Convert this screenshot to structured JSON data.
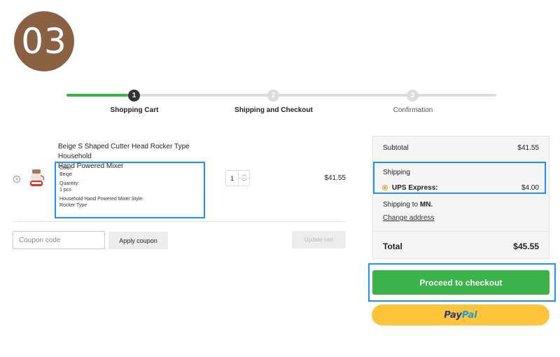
{
  "step_badge": "03",
  "progress": {
    "steps": [
      {
        "number": "1",
        "label": "Shopping Cart"
      },
      {
        "number": "2",
        "label": "Shipping and Checkout"
      },
      {
        "number": "3",
        "label": "Confirmation"
      }
    ],
    "active_color": "#3bb24a"
  },
  "cart": {
    "item": {
      "title_line1": "Beige S Shaped Cutter Head Rocker Type Household",
      "title_line2": "Hand Powered Mixer",
      "color_label": "Color:",
      "color_value": "Beige",
      "quantity_label": "Quantity:",
      "quantity_value": "1 pcs",
      "style_label": "Household Hand Powered Mixer Style:",
      "style_value": "Rocker Type",
      "qty": "1",
      "price": "$41.55"
    },
    "coupon_placeholder": "Coupon code",
    "apply_coupon_label": "Apply coupon",
    "update_cart_label": "Update cart"
  },
  "summary": {
    "subtotal_label": "Subtotal",
    "subtotal_value": "$41.55",
    "shipping_label": "Shipping",
    "shipping_method": "UPS Express:",
    "shipping_value": "$4.00",
    "shipping_to_prefix": "Shipping to",
    "shipping_to_state": "MN.",
    "change_address_label": "Change address",
    "total_label": "Total",
    "total_value": "$45.55"
  },
  "checkout_label": "Proceed to checkout",
  "paypal": {
    "pay": "Pay",
    "pal": "Pal"
  },
  "colors": {
    "badge": "#8a6243",
    "checkout_green": "#3bb24a",
    "paypal_yellow": "#ffc439",
    "highlight_blue": "#1e90ff"
  }
}
